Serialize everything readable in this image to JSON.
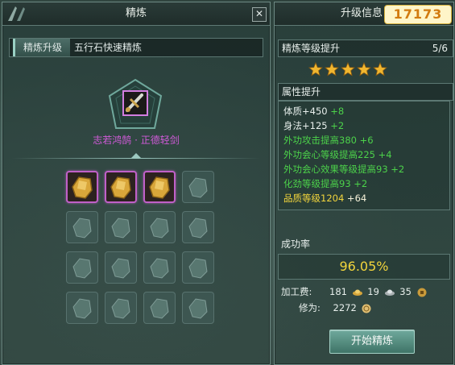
{
  "left_window": {
    "title": "精炼",
    "close_label": "✕",
    "tabs": [
      {
        "label": "精炼升级",
        "active": true
      },
      {
        "label": "五行石快速精炼",
        "active": false
      }
    ],
    "equipment_name": "志若鸿鹄 · 正德轻剑",
    "material_grid": {
      "rows": 4,
      "cols": 4,
      "filled_slots": 3
    }
  },
  "right_window": {
    "title": "升级信息",
    "logo_text": "17173",
    "refine_level": {
      "label": "精炼等级提升",
      "count": "5/6",
      "stars_filled": 5,
      "stars_total": 5
    },
    "attributes": {
      "label": "属性提升",
      "lines": [
        {
          "text": "体质+450",
          "bonus": "+8",
          "color": "#e8efec"
        },
        {
          "text": "身法+125",
          "bonus": "+2",
          "color": "#e8efec"
        },
        {
          "text": "外功攻击提高380",
          "bonus": "+6",
          "color": "#4cd24a"
        },
        {
          "text": "外功会心等级提高225",
          "bonus": "+4",
          "color": "#4cd24a"
        },
        {
          "text": "外功会心效果等级提高93",
          "bonus": "+2",
          "color": "#4cd24a"
        },
        {
          "text": "化劲等级提高93",
          "bonus": "+2",
          "color": "#4cd24a"
        },
        {
          "text": "品质等级1204",
          "bonus": "+64",
          "color": "#f2d53c"
        }
      ]
    },
    "success_rate": {
      "label": "成功率",
      "value": "96.05%"
    },
    "cost": {
      "label": "加工费:",
      "gold": "181",
      "silver": "19",
      "copper": "35"
    },
    "cultivation": {
      "label": "修为:",
      "value": "2272"
    },
    "start_button": "开始精炼"
  },
  "colors": {
    "accent": "#9ad1c4",
    "gold_text": "#f2d53c",
    "bonus_green": "#4cd24a",
    "equip_name": "#d05ad8",
    "slot_border": "#c060c8"
  }
}
